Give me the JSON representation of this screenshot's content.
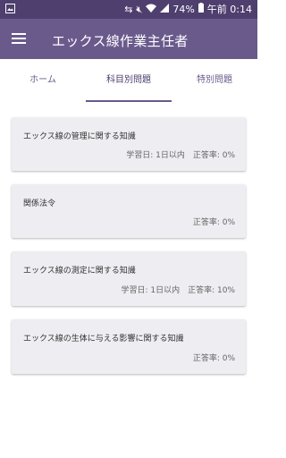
{
  "status": {
    "battery": "74%",
    "time": "午前 0:14",
    "icons": [
      "image-icon",
      "sync-icon",
      "mute-icon",
      "wifi-icon",
      "signal-icon",
      "battery-icon"
    ]
  },
  "app": {
    "title": "エックス線作業主任者",
    "theme": {
      "appbar": "#6a5a8c",
      "statusbar": "#4e3f6e",
      "accent": "#6a5a8c"
    }
  },
  "tabs": [
    {
      "label": "ホーム"
    },
    {
      "label": "科目別問題",
      "active": true
    },
    {
      "label": "特別問題"
    }
  ],
  "subjects": [
    {
      "title": "エックス線の管理に関する知識",
      "meta": "学習日: 1日以内　正答率: 0%"
    },
    {
      "title": "関係法令",
      "meta": "正答率: 0%"
    },
    {
      "title": "エックス線の測定に関する知識",
      "meta": "学習日: 1日以内　正答率: 10%"
    },
    {
      "title": "エックス線の生体に与える影響に関する知識",
      "meta": "正答率: 0%"
    }
  ]
}
